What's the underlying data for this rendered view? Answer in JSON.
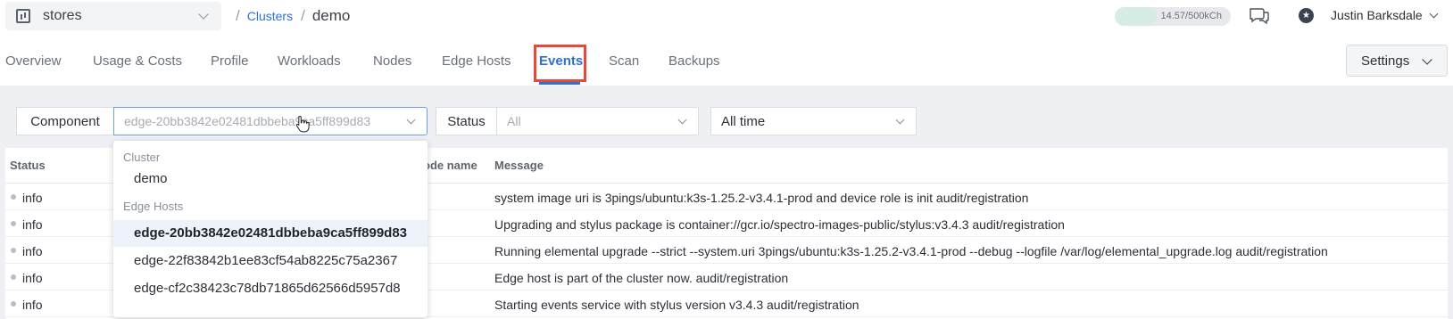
{
  "header": {
    "project": "stores",
    "breadcrumb_link": "Clusters",
    "breadcrumb_current": "demo",
    "usage_text": "14.57/500kCh",
    "usage_fraction": 0.029,
    "user_name": "Justin Barksdale"
  },
  "tabs": [
    "Overview",
    "Usage & Costs",
    "Profile",
    "Workloads",
    "Nodes",
    "Edge Hosts",
    "Events",
    "Scan",
    "Backups"
  ],
  "active_tab": "Events",
  "settings_label": "Settings",
  "filters": {
    "component_label": "Component",
    "component_value": "edge-20bb3842e02481dbbeba9ca5ff899d83",
    "status_label": "Status",
    "status_value": "All",
    "time_value": "All time"
  },
  "table": {
    "headers": {
      "status": "Status",
      "node_name": "ode name",
      "message": "Message"
    },
    "rows": [
      {
        "status": "info",
        "message": "system image uri is 3pings/ubuntu:k3s-1.25.2-v3.4.1-prod and device role is init audit/registration"
      },
      {
        "status": "info",
        "message": "Upgrading and stylus package is container://gcr.io/spectro-images-public/stylus:v3.4.3 audit/registration"
      },
      {
        "status": "info",
        "message": "Running elemental upgrade --strict --system.uri 3pings/ubuntu:k3s-1.25.2-v3.4.1-prod --debug --logfile /var/log/elemental_upgrade.log audit/registration"
      },
      {
        "status": "info",
        "message": "Edge host is part of the cluster now. audit/registration"
      },
      {
        "status": "info",
        "message": "Starting events service with stylus version v3.4.3 audit/registration"
      }
    ]
  },
  "dropdown": {
    "group_cluster": "Cluster",
    "cluster_option": "demo",
    "group_edge": "Edge Hosts",
    "edge_options": [
      "edge-20bb3842e02481dbbeba9ca5ff899d83",
      "edge-22f83842b1ee83cf54ab8225c75a2367",
      "edge-cf2c38423c78db71865d62566d5957d8"
    ]
  },
  "colors": {
    "accent": "#2f6fd8",
    "highlight": "#e24b3c"
  }
}
